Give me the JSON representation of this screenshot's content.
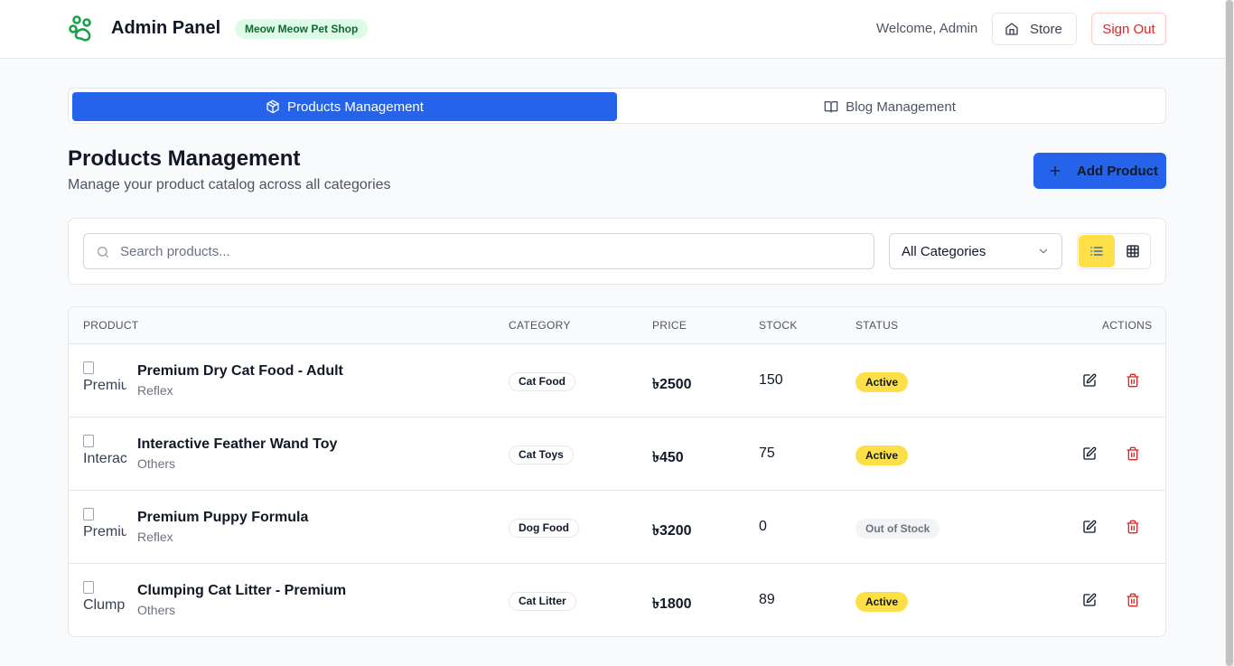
{
  "header": {
    "app_title": "Admin Panel",
    "shop_badge": "Meow Meow Pet Shop",
    "welcome": "Welcome, Admin",
    "store_label": "Store",
    "signout_label": "Sign Out"
  },
  "tabs": [
    {
      "label": "Products Management",
      "active": true,
      "icon": "box-icon"
    },
    {
      "label": "Blog Management",
      "active": false,
      "icon": "book-icon"
    }
  ],
  "page": {
    "title": "Products Management",
    "subtitle": "Manage your product catalog across all categories",
    "add_label": "Add Product"
  },
  "filters": {
    "search_placeholder": "Search products...",
    "search_value": "",
    "category_selected": "All Categories",
    "view_mode": "list"
  },
  "table": {
    "headers": {
      "product": "PRODUCT",
      "category": "CATEGORY",
      "price": "PRICE",
      "stock": "STOCK",
      "status": "STATUS",
      "actions": "ACTIONS"
    },
    "rows": [
      {
        "thumb_alt": "Premiu",
        "name": "Premium Dry Cat Food - Adult",
        "brand": "Reflex",
        "category": "Cat Food",
        "price": "৳2500",
        "stock": "150",
        "status": "Active"
      },
      {
        "thumb_alt": "Interac",
        "name": "Interactive Feather Wand Toy",
        "brand": "Others",
        "category": "Cat Toys",
        "price": "৳450",
        "stock": "75",
        "status": "Active"
      },
      {
        "thumb_alt": "Premiu",
        "name": "Premium Puppy Formula",
        "brand": "Reflex",
        "category": "Dog Food",
        "price": "৳3200",
        "stock": "0",
        "status": "Out of Stock"
      },
      {
        "thumb_alt": "Clump",
        "name": "Clumping Cat Litter - Premium",
        "brand": "Others",
        "category": "Cat Litter",
        "price": "৳1800",
        "stock": "89",
        "status": "Active"
      }
    ]
  },
  "colors": {
    "primary": "#2563eb",
    "accent_yellow": "#fde047",
    "danger": "#dc2626",
    "brand_green": "#16a34a"
  }
}
